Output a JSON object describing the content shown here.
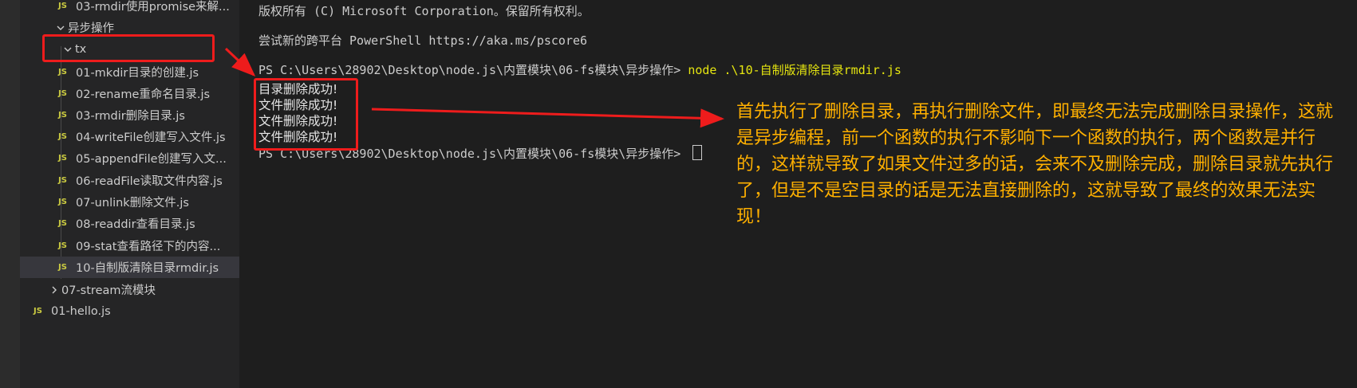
{
  "sidebar": {
    "items": [
      {
        "type": "file",
        "badge": "JS",
        "label": "03-rmdir使用promise来解..."
      },
      {
        "type": "folder",
        "expanded": true,
        "label": "异步操作"
      },
      {
        "type": "folder",
        "expanded": true,
        "label": "tx"
      },
      {
        "type": "file",
        "badge": "JS",
        "label": "01-mkdir目录的创建.js"
      },
      {
        "type": "file",
        "badge": "JS",
        "label": "02-rename重命名目录.js"
      },
      {
        "type": "file",
        "badge": "JS",
        "label": "03-rmdir删除目录.js"
      },
      {
        "type": "file",
        "badge": "JS",
        "label": "04-writeFile创建写入文件.js"
      },
      {
        "type": "file",
        "badge": "JS",
        "label": "05-appendFile创建写入文..."
      },
      {
        "type": "file",
        "badge": "JS",
        "label": "06-readFile读取文件内容.js"
      },
      {
        "type": "file",
        "badge": "JS",
        "label": "07-unlink删除文件.js"
      },
      {
        "type": "file",
        "badge": "JS",
        "label": "08-readdir查看目录.js"
      },
      {
        "type": "file",
        "badge": "JS",
        "label": "09-stat查看路径下的内容..."
      },
      {
        "type": "file",
        "badge": "JS",
        "label": "10-自制版清除目录rmdir.js",
        "selected": true
      },
      {
        "type": "folder",
        "expanded": false,
        "label": "07-stream流模块"
      },
      {
        "type": "file",
        "badge": "JS",
        "label": "01-hello.js"
      }
    ]
  },
  "terminal": {
    "copyright": "版权所有 (C) Microsoft Corporation。保留所有权利。",
    "pscore": "尝试新的跨平台 PowerShell https://aka.ms/pscore6",
    "prompt1": "PS C:\\Users\\28902\\Desktop\\node.js\\内置模块\\06-fs模块\\异步操作> ",
    "command": "node .\\10-自制版清除目录rmdir.js",
    "output": [
      "目录删除成功!",
      "文件删除成功!",
      "文件删除成功!",
      "文件删除成功!"
    ],
    "prompt2": "PS C:\\Users\\28902\\Desktop\\node.js\\内置模块\\06-fs模块\\异步操作> "
  },
  "annotation": {
    "text": "首先执行了删除目录，再执行删除文件，即最终无法完成删除目录操作，这就是异步编程，前一个函数的执行不影响下一个函数的执行，两个函数是并行的，这样就导致了如果文件过多的话，会来不及删除完成，删除目录就先执行了，但是不是空目录的话是无法直接删除的，这就导致了最终的效果无法实现！",
    "color": "#ffb000",
    "highlight_color": "#ee1c1c"
  },
  "colors": {
    "js_badge": "#cbcb41",
    "sidebar_bg": "#252526",
    "terminal_bg": "#1e1e1e",
    "command": "#e5e510"
  }
}
